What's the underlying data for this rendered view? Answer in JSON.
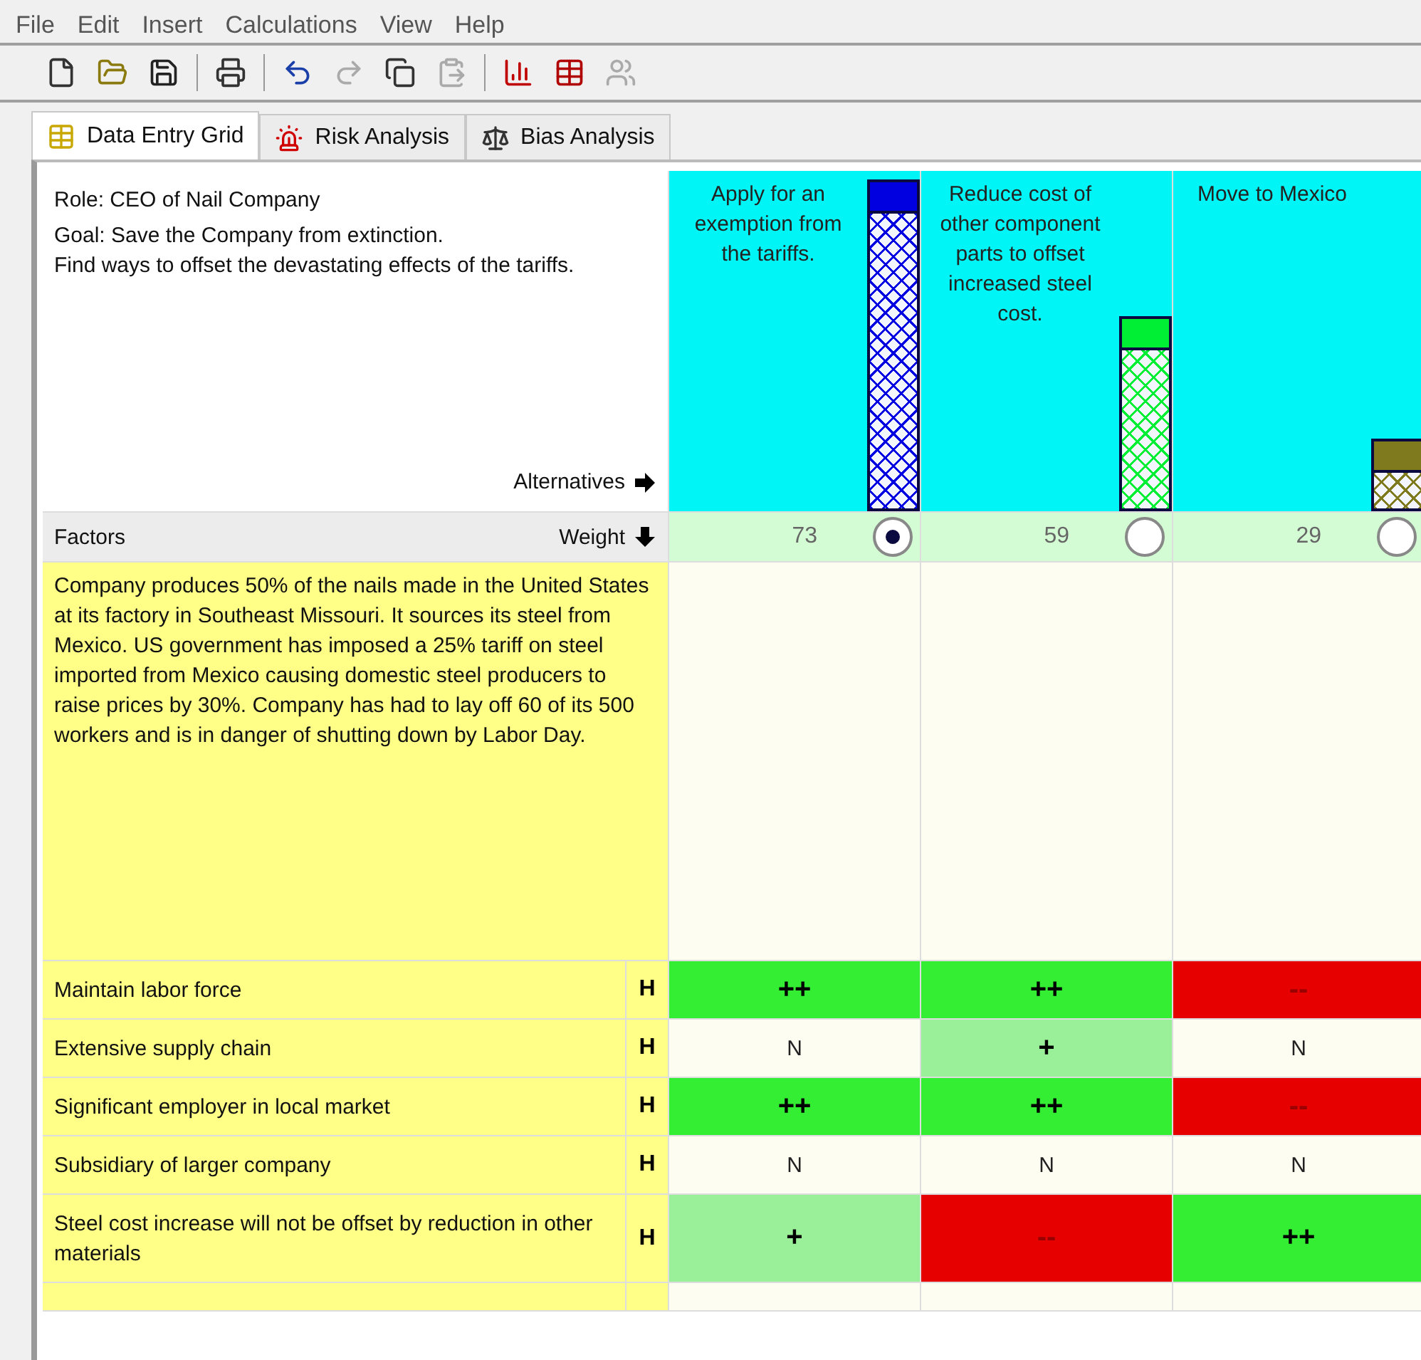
{
  "menu": [
    "File",
    "Edit",
    "Insert",
    "Calculations",
    "View",
    "Help"
  ],
  "toolbar": [
    {
      "kind": "new",
      "disabled": false
    },
    {
      "kind": "open",
      "disabled": false
    },
    {
      "kind": "save",
      "disabled": false
    },
    {
      "kind": "separator"
    },
    {
      "kind": "print",
      "disabled": false
    },
    {
      "kind": "separator"
    },
    {
      "kind": "undo",
      "disabled": false
    },
    {
      "kind": "redo",
      "disabled": true
    },
    {
      "kind": "copy",
      "disabled": false
    },
    {
      "kind": "paste",
      "disabled": true
    },
    {
      "kind": "separator"
    },
    {
      "kind": "chart",
      "disabled": false
    },
    {
      "kind": "table",
      "disabled": false
    },
    {
      "kind": "people",
      "disabled": true
    }
  ],
  "tabs": [
    {
      "label": "Data Entry Grid",
      "kind": "grid",
      "selected": true
    },
    {
      "label": "Risk Analysis",
      "kind": "risk",
      "selected": false
    },
    {
      "label": "Bias Analysis",
      "kind": "bias",
      "selected": false
    }
  ],
  "grid": {
    "role": "Role: CEO of Nail Company",
    "goal": [
      "Goal: Save the Company from extinction.",
      "Find ways to offset the devastating effects of the tariffs."
    ],
    "alternatives_label": "Alternatives",
    "factors_label": "Factors",
    "weight_label": "Weight",
    "alternatives": [
      {
        "title": "Apply for an exemption from the tariffs.",
        "score": "73",
        "color": "#0000e0",
        "level": 1.0,
        "selected": true
      },
      {
        "title": "Reduce cost of other component parts to offset increased steel cost.",
        "score": "59",
        "color": "#00ee33",
        "level": 0.59,
        "selected": false
      },
      {
        "title": "Move to Mexico",
        "score": "29",
        "color": "#7f7a1e",
        "level": 0.22,
        "selected": false
      }
    ],
    "description": "Company produces 50% of the nails made in the United States at its factory in Southeast Missouri. It sources its steel from Mexico. US government has imposed a 25% tariff on steel imported from Mexico causing domestic steel producers to raise prices by 30%. Company has had to lay off 60 of its 500 workers and is in danger of shutting down by Labor Day.",
    "factors": [
      {
        "name": "Maintain labor force",
        "importance": "H",
        "ratings": [
          {
            "text": "++",
            "kind": "strong_positive"
          },
          {
            "text": "++",
            "kind": "strong_positive"
          },
          {
            "text": "--",
            "kind": "strong_negative"
          }
        ]
      },
      {
        "name": "Extensive supply chain",
        "importance": "H",
        "ratings": [
          {
            "text": "N",
            "kind": "neutral"
          },
          {
            "text": "+",
            "kind": "positive"
          },
          {
            "text": "N",
            "kind": "neutral"
          }
        ]
      },
      {
        "name": "Significant employer in local market",
        "importance": "H",
        "ratings": [
          {
            "text": "++",
            "kind": "strong_positive"
          },
          {
            "text": "++",
            "kind": "strong_positive"
          },
          {
            "text": "--",
            "kind": "strong_negative"
          }
        ]
      },
      {
        "name": "Subsidiary of larger company",
        "importance": "H",
        "ratings": [
          {
            "text": "N",
            "kind": "neutral"
          },
          {
            "text": "N",
            "kind": "neutral"
          },
          {
            "text": "N",
            "kind": "neutral"
          }
        ]
      },
      {
        "name": "Steel cost increase will not be offset by reduction in other materials",
        "importance": "H",
        "ratings": [
          {
            "text": "+",
            "kind": "positive"
          },
          {
            "text": "--",
            "kind": "strong_negative"
          },
          {
            "text": "++",
            "kind": "strong_positive"
          }
        ]
      }
    ]
  }
}
